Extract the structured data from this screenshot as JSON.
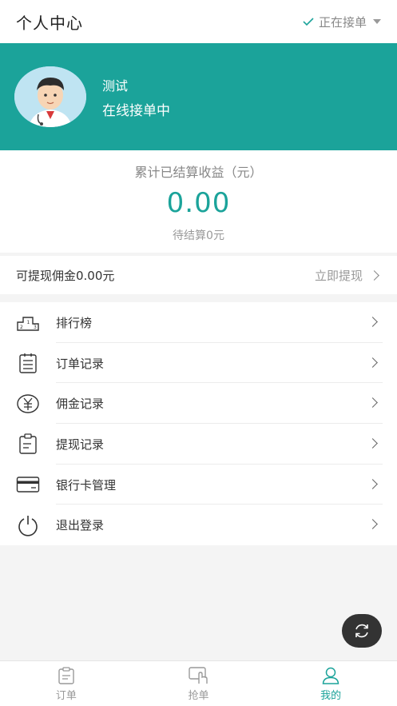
{
  "header": {
    "title": "个人中心",
    "status_label": "正在接单"
  },
  "profile": {
    "name": "测试",
    "status": "在线接单中"
  },
  "earnings": {
    "label": "累计已结算收益（元）",
    "amount": "0.00",
    "pending": "待结算0元"
  },
  "withdraw": {
    "available": "可提现佣金0.00元",
    "action": "立即提现"
  },
  "menu": [
    {
      "label": "排行榜",
      "icon": "ranking-icon"
    },
    {
      "label": "订单记录",
      "icon": "order-list-icon"
    },
    {
      "label": "佣金记录",
      "icon": "yuan-coin-icon"
    },
    {
      "label": "提现记录",
      "icon": "clipboard-icon"
    },
    {
      "label": "银行卡管理",
      "icon": "bank-card-icon"
    },
    {
      "label": "退出登录",
      "icon": "power-icon"
    }
  ],
  "tabs": [
    {
      "label": "订单",
      "icon": "order-icon",
      "active": false
    },
    {
      "label": "抢单",
      "icon": "grab-order-icon",
      "active": false
    },
    {
      "label": "我的",
      "icon": "user-icon",
      "active": true
    }
  ],
  "colors": {
    "accent": "#1ba39a",
    "fab": "#333333"
  }
}
